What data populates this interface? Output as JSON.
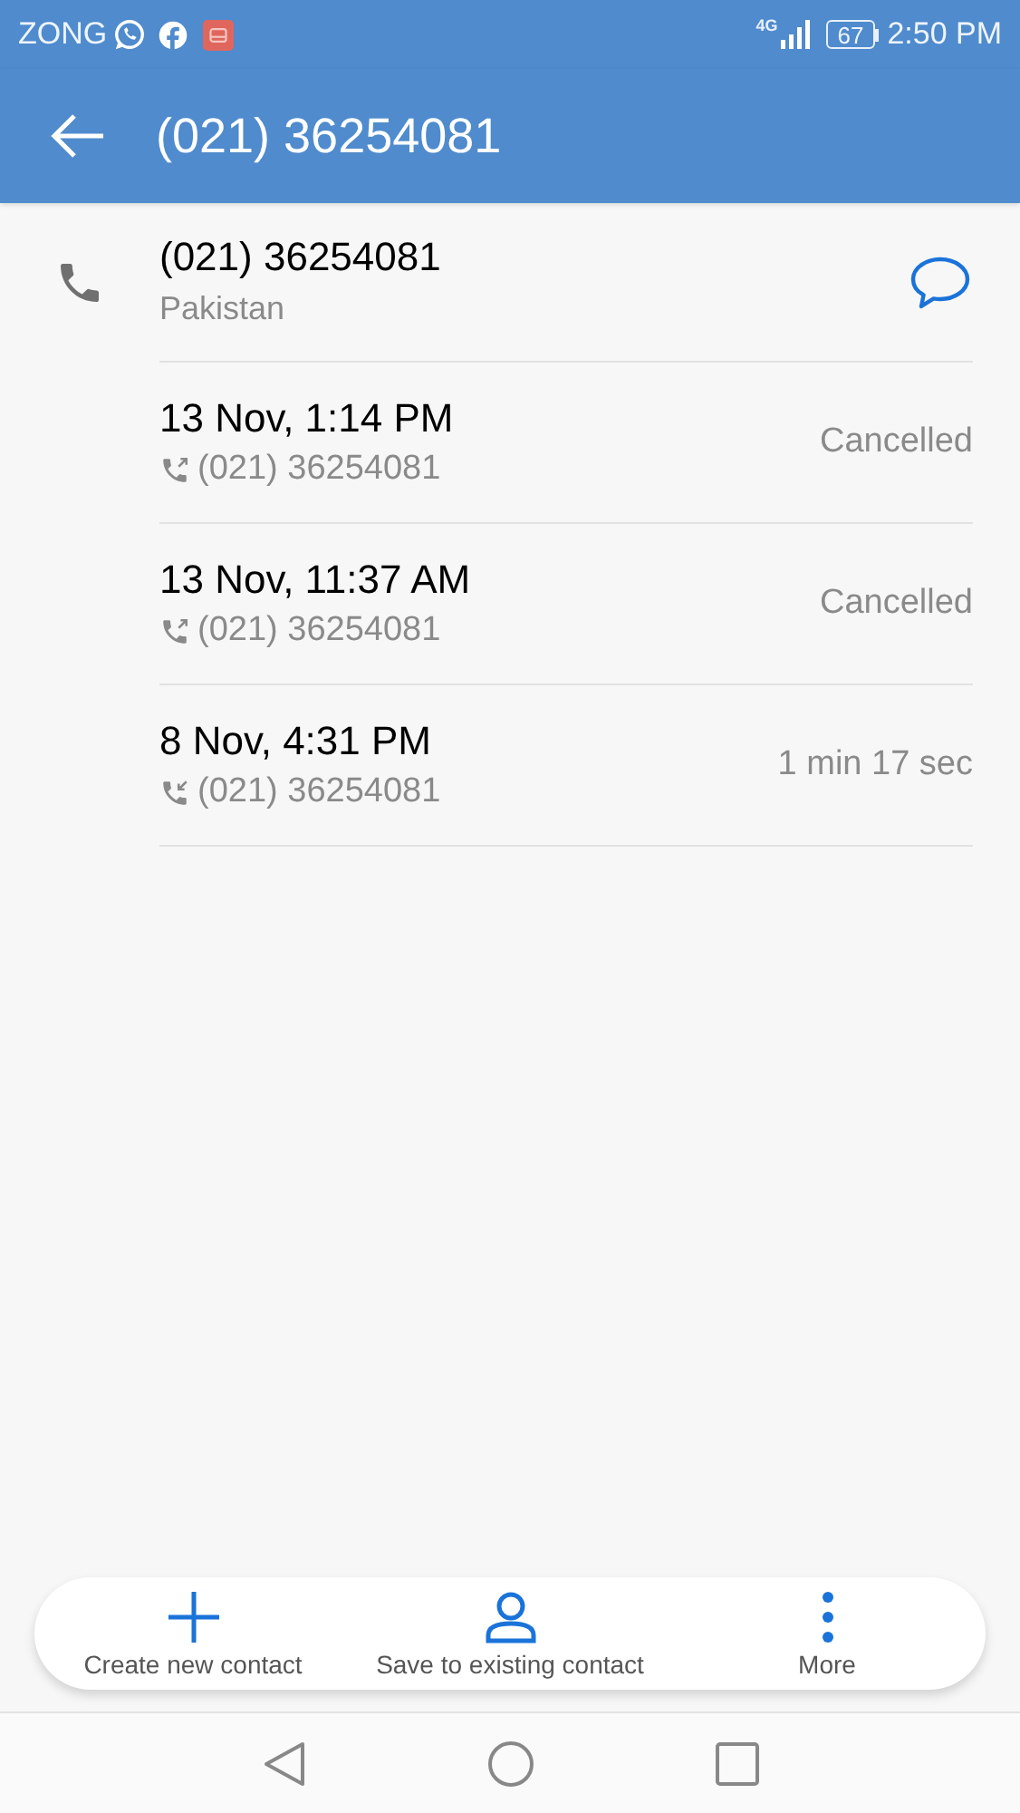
{
  "status_bar": {
    "carrier": "ZONG",
    "network": "4G",
    "battery": "67",
    "time": "2:50 PM"
  },
  "app_bar": {
    "title": "(021) 36254081"
  },
  "contact": {
    "number": "(021) 36254081",
    "location": "Pakistan"
  },
  "calls": [
    {
      "kind": "outgoing",
      "date": "13 Nov, 1:14 PM",
      "number": "(021) 36254081",
      "result": "Cancelled"
    },
    {
      "kind": "outgoing",
      "date": "13 Nov, 11:37 AM",
      "number": "(021) 36254081",
      "result": "Cancelled"
    },
    {
      "kind": "incoming",
      "date": "8 Nov, 4:31 PM",
      "number": "(021) 36254081",
      "result": "1 min 17 sec"
    }
  ],
  "actions": [
    {
      "kind": "add",
      "label": "Create new contact"
    },
    {
      "kind": "person",
      "label": "Save to existing contact"
    },
    {
      "kind": "more",
      "label": "More"
    }
  ]
}
